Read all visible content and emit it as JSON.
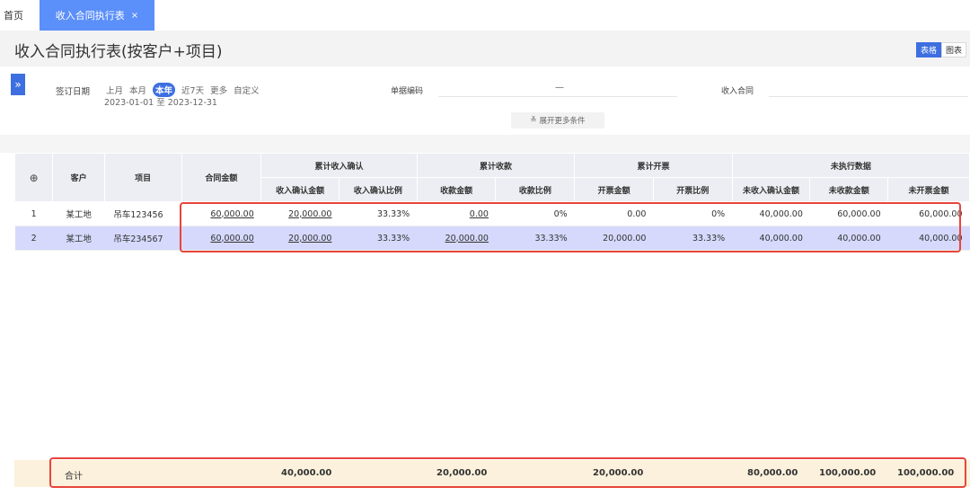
{
  "tabs": {
    "home": "首页",
    "active": "收入合同执行表",
    "close": "×"
  },
  "page": {
    "title": "收入合同执行表(按客户+项目)"
  },
  "view_toggle": {
    "table": "表格",
    "chart": "图表"
  },
  "filter": {
    "expander": "»",
    "date_label": "签订日期",
    "quick_options": [
      "上月",
      "本月",
      "本年",
      "近7天",
      "更多",
      "自定义"
    ],
    "date_range": "2023-01-01 至 2023-12-31",
    "code_label": "单据编码",
    "code_separator": "—",
    "contract_label": "收入合同",
    "expand_more": "展开更多条件"
  },
  "table": {
    "headers": {
      "add": "⊕",
      "customer": "客户",
      "project": "项目",
      "contract_amount": "合同金额",
      "group_confirm": "累计收入确认",
      "group_receipt": "累计收款",
      "group_invoice": "累计开票",
      "group_unexecuted": "未执行数据",
      "confirm_amount": "收入确认金额",
      "confirm_ratio": "收入确认比例",
      "receipt_amount": "收款金额",
      "receipt_ratio": "收款比例",
      "invoice_amount": "开票金额",
      "invoice_ratio": "开票比例",
      "un_confirm": "未收入确认金额",
      "un_receipt": "未收款金额",
      "un_invoice": "未开票金额"
    },
    "rows": [
      {
        "no": "1",
        "customer": "某工地",
        "project": "吊车123456",
        "contract_amount": "60,000.00",
        "confirm_amount": "20,000.00",
        "confirm_ratio": "33.33%",
        "receipt_amount": "0.00",
        "receipt_ratio": "0%",
        "invoice_amount": "0.00",
        "invoice_ratio": "0%",
        "un_confirm": "40,000.00",
        "un_receipt": "60,000.00",
        "un_invoice": "60,000.00"
      },
      {
        "no": "2",
        "customer": "某工地",
        "project": "吊车234567",
        "contract_amount": "60,000.00",
        "confirm_amount": "20,000.00",
        "confirm_ratio": "33.33%",
        "receipt_amount": "20,000.00",
        "receipt_ratio": "33.33%",
        "invoice_amount": "20,000.00",
        "invoice_ratio": "33.33%",
        "un_confirm": "40,000.00",
        "un_receipt": "40,000.00",
        "un_invoice": "40,000.00"
      }
    ],
    "totals": {
      "label": "合计",
      "confirm_amount": "40,000.00",
      "receipt_amount": "20,000.00",
      "invoice_amount": "20,000.00",
      "un_confirm": "80,000.00",
      "un_receipt": "100,000.00",
      "un_invoice": "100,000.00"
    }
  },
  "colors": {
    "accent": "#3d6fe0",
    "tab_active": "#5b8ff9",
    "highlight": "#e8453c",
    "selected_row": "#d6d9fb",
    "total_row": "#fcf1dc"
  }
}
